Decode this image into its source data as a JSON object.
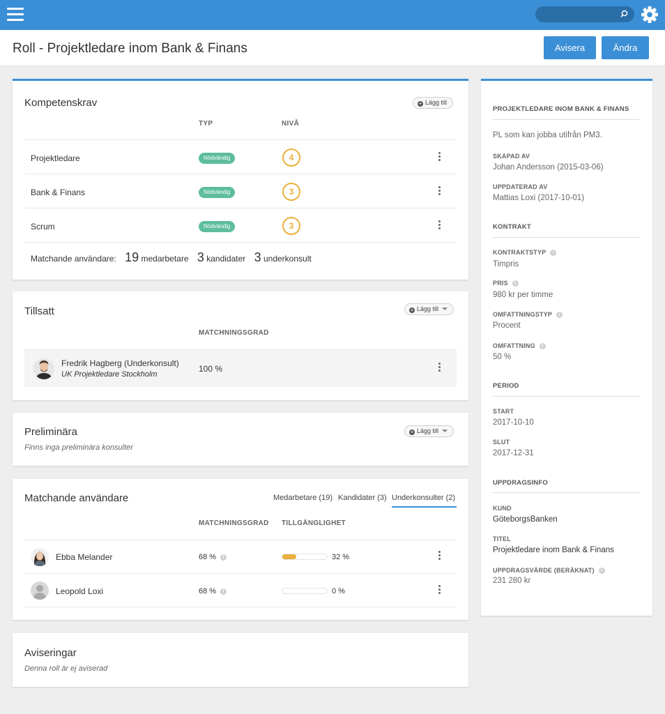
{
  "topbar": {
    "search_placeholder": "",
    "accent_color": "#3a8fd6",
    "icons": [
      "hamburger-icon",
      "search-icon",
      "gear-icon"
    ]
  },
  "header": {
    "title": "Roll - Projektledare inom Bank & Finans",
    "avisera_label": "Avisera",
    "andra_label": "Ändra"
  },
  "kompetens": {
    "title": "Kompetenskrav",
    "add_label": "Lägg till",
    "col_typ": "TYP",
    "col_niva": "NIVÅ",
    "rows": [
      {
        "name": "Projektledare",
        "typ": "Nödvändig",
        "niva": "4"
      },
      {
        "name": "Bank & Finans",
        "typ": "Nödvändig",
        "niva": "3"
      },
      {
        "name": "Scrum",
        "typ": "Nödvändig",
        "niva": "3"
      }
    ],
    "match_label": "Matchande användare:",
    "match": [
      {
        "count": "19",
        "label": "medarbetare"
      },
      {
        "count": "3",
        "label": "kandidater"
      },
      {
        "count": "3",
        "label": "underkonsult"
      }
    ]
  },
  "tillsatt": {
    "title": "Tillsatt",
    "add_label": "Lägg till",
    "col_match": "MATCHNINGSGRAD",
    "person_name": "Fredrik Hagberg (Underkonsult)",
    "person_sub": "UK Projektledare Stockholm",
    "match": "100 %"
  },
  "preliminara": {
    "title": "Preliminära",
    "add_label": "Lägg till",
    "note": "Finns inga preliminära konsulter"
  },
  "matchande": {
    "title": "Matchande användare",
    "tabs": [
      "Medarbetare (19)",
      "Kandidater (3)",
      "Underkonsulter (2)"
    ],
    "active_tab": "Underkonsulter (2)",
    "col_match": "MATCHNINGSGRAD",
    "col_avail": "TILLGÄNGLIGHET",
    "rows": [
      {
        "name": "Ebba Melander",
        "match": "68 %",
        "availability": "32 %",
        "availability_fraction": 0.32
      },
      {
        "name": "Leopold Loxi",
        "match": "68 %",
        "availability": "0 %",
        "availability_fraction": 0
      }
    ]
  },
  "aviseringar": {
    "title": "Aviseringar",
    "note": "Denna roll är ej aviserad"
  },
  "sidebar": {
    "role_heading": "PROJEKTLEDARE INOM BANK & FINANS",
    "description": "PL som kan jobba utifrån PM3.",
    "skapad_label": "SKAPAD AV",
    "skapad_value": "Johan Andersson (2015-03-06)",
    "uppdaterad_label": "UPPDATERAD AV",
    "uppdaterad_value": "Mattias Loxi (2017-10-01)",
    "kontrakt_heading": "KONTRAKT",
    "kontraktstyp_label": "KONTRAKTSTYP",
    "kontraktstyp_value": "Timpris",
    "pris_label": "PRIS",
    "pris_value": "980 kr per timme",
    "omfattningstyp_label": "OMFATTNINGSTYP",
    "omfattningstyp_value": "Procent",
    "omfattning_label": "OMFATTNING",
    "omfattning_value": "50 %",
    "period_heading": "PERIOD",
    "start_label": "START",
    "start_value": "2017-10-10",
    "slut_label": "SLUT",
    "slut_value": "2017-12-31",
    "uppdrag_heading": "UPPDRAGSINFO",
    "kund_label": "KUND",
    "kund_value": "GöteborgsBanken",
    "titel_label": "TITEL",
    "titel_value": "Projektledare inom Bank & Finans",
    "varde_label": "UPPDRAGSVÄRDE (BERÄKNAT)",
    "varde_value": "231 280 kr"
  }
}
